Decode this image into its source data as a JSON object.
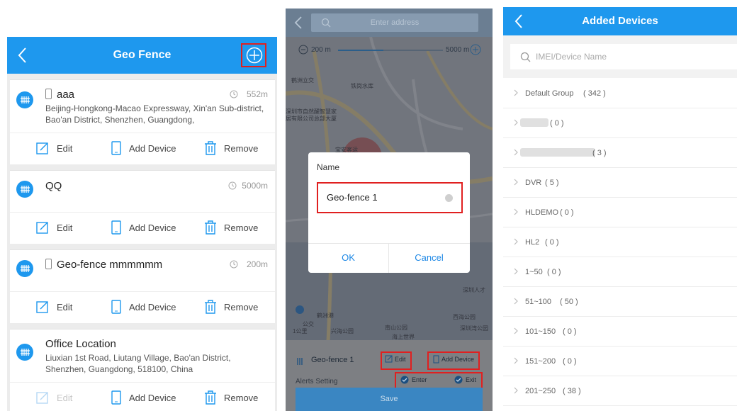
{
  "geo_fence_screen": {
    "title": "Geo Fence",
    "fences": [
      {
        "name": "aaa",
        "distance": "552m",
        "address": "Beijing-Hongkong-Macao Expressway, Xin'an Sub-district, Bao'an District, Shenzhen, Guangdong,"
      },
      {
        "name": "QQ",
        "distance": "5000m",
        "address": ""
      },
      {
        "name": "Geo-fence mmmmmm",
        "distance": "200m",
        "address": ""
      },
      {
        "name": "Office Location",
        "distance": "",
        "address": "Liuxian 1st Road, Liutang Village, Bao'an District, Shenzhen, Guangdong, 518100, China"
      }
    ],
    "actions": {
      "edit": "Edit",
      "add_device": "Add Device",
      "remove": "Remove"
    }
  },
  "map_screen": {
    "search_placeholder": "Enter address",
    "radius_min": "200 m",
    "radius_max": "5000 m",
    "map_labels": [
      "鹤洲立交",
      "铁岗水库",
      "深圳市自然醒智慧家",
      "居有限公司总部大厦",
      "宝安客运",
      "鹤洲港",
      "兴海公园",
      "南山公园",
      "海上世界",
      "深圳湾公园",
      "西海公园",
      "深圳人才",
      "公交",
      "1公里"
    ],
    "dialog": {
      "label": "Name",
      "value": "Geo-fence 1",
      "ok": "OK",
      "cancel": "Cancel"
    },
    "bottom": {
      "fence_name": "Geo-fence 1",
      "edit": "Edit",
      "add_device": "Add Device",
      "alerts_label": "Alerts Setting",
      "enter": "Enter",
      "exit": "Exit",
      "save": "Save"
    }
  },
  "devices_screen": {
    "title": "Added Devices",
    "search_placeholder": "IMEI/Device Name",
    "groups": [
      {
        "name": "Default Group",
        "count": "( 342 )"
      },
      {
        "name": "",
        "count": "( 0 )"
      },
      {
        "name": "",
        "count": "( 3 )"
      },
      {
        "name": "DVR",
        "count": "( 5 )"
      },
      {
        "name": "HLDEMO",
        "count": "( 0 )"
      },
      {
        "name": "HL2",
        "count": "( 0 )"
      },
      {
        "name": "1~50",
        "count": "( 0 )"
      },
      {
        "name": "51~100",
        "count": "( 50 )"
      },
      {
        "name": "101~150",
        "count": "( 0 )"
      },
      {
        "name": "151~200",
        "count": "( 0 )"
      },
      {
        "name": "201~250",
        "count": "( 38 )"
      }
    ]
  },
  "colors": {
    "primary": "#1e98ee",
    "highlight_box": "#e02020"
  }
}
